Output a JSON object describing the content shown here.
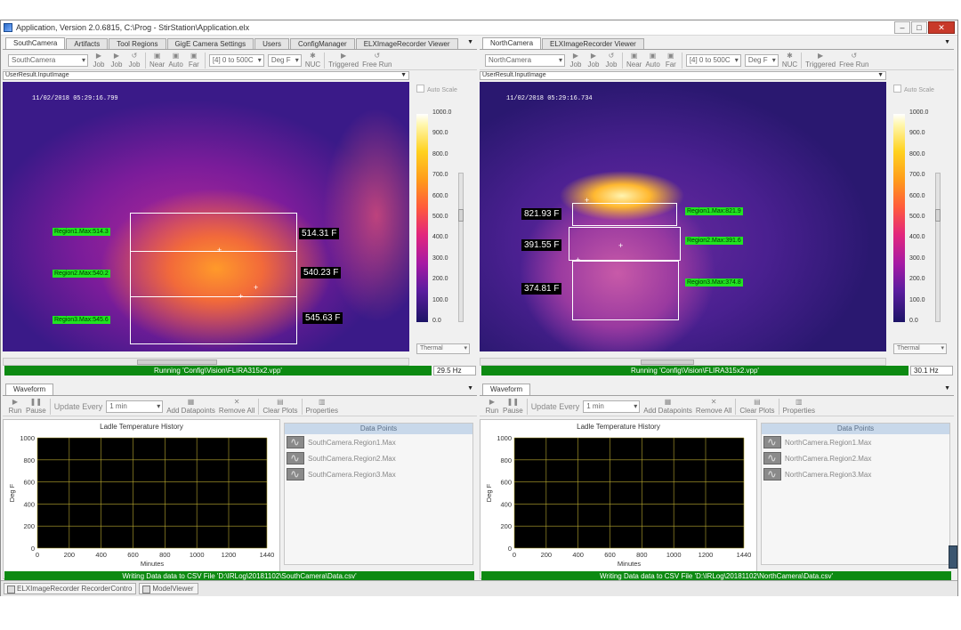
{
  "window": {
    "title": "Application, Version 2.0.6815, C:\\Prog - StirStation\\Application.elx",
    "controls": {
      "minimize": "–",
      "maximize": "□",
      "close": "✕"
    }
  },
  "left": {
    "tabs": [
      "SouthCamera",
      "Artifacts",
      "Tool Regions",
      "GigE Camera Settings",
      "Users",
      "ConfigManager",
      "ELXImageRecorder Viewer"
    ],
    "toolbar": {
      "camera": "SouthCamera",
      "buttons": [
        "Job",
        "Job",
        "Job",
        "Near",
        "Auto",
        "Far"
      ],
      "range": "[4] 0 to 500C",
      "units": "Deg F",
      "nuc": "NUC",
      "triggered": "Triggered",
      "free_run": "Free Run"
    },
    "image_source": "UserResult.InputImage",
    "timestamp": "11/02/2018 05:29:16.799",
    "regions": [
      {
        "label": "Region1.Max:514.3",
        "temp": "514.31 F"
      },
      {
        "label": "Region2.Max:540.2",
        "temp": "540.23 F"
      },
      {
        "label": "Region3.Max:545.6",
        "temp": "545.63 F"
      }
    ],
    "scale": {
      "auto_scale": "Auto Scale",
      "ticks": [
        "1000.0",
        "900.0",
        "800.0",
        "700.0",
        "600.0",
        "500.0",
        "400.0",
        "300.0",
        "200.0",
        "100.0",
        "0.0"
      ],
      "palette": "Thermal"
    },
    "status": "Running 'Config\\Vision\\FLIRA315x2.vpp'",
    "hz": "29.5 Hz",
    "waveform": {
      "tab": "Waveform",
      "toolbar": {
        "run": "Run",
        "pause": "Pause",
        "update_every": "Update Every",
        "interval": "1 min",
        "add": "Add Datapoints",
        "remove": "Remove All",
        "clear": "Clear Plots",
        "properties": "Properties"
      },
      "chart_title": "Ladle Temperature History",
      "data_points_header": "Data Points",
      "series": [
        "SouthCamera.Region1.Max",
        "SouthCamera.Region2.Max",
        "SouthCamera.Region3.Max"
      ]
    },
    "csv_status": "Writing Data data to CSV File 'D:\\IRLog\\20181102\\SouthCamera\\Data.csv'"
  },
  "right": {
    "tabs": [
      "NorthCamera",
      "ELXImageRecorder Viewer"
    ],
    "toolbar": {
      "camera": "NorthCamera",
      "buttons": [
        "Job",
        "Job",
        "Job",
        "Near",
        "Auto",
        "Far"
      ],
      "range": "[4] 0 to 500C",
      "units": "Deg F",
      "nuc": "NUC",
      "triggered": "Triggered",
      "free_run": "Free Run"
    },
    "image_source": "UserResult.InputImage",
    "timestamp": "11/02/2018 05:29:16.734",
    "regions": [
      {
        "label": "Region1.Max:821.9",
        "temp": "821.93 F"
      },
      {
        "label": "Region2.Max:391.6",
        "temp": "391.55 F"
      },
      {
        "label": "Region3.Max:374.8",
        "temp": "374.81 F"
      }
    ],
    "scale": {
      "auto_scale": "Auto Scale",
      "ticks": [
        "1000.0",
        "900.0",
        "800.0",
        "700.0",
        "600.0",
        "500.0",
        "400.0",
        "300.0",
        "200.0",
        "100.0",
        "0.0"
      ],
      "palette": "Thermal"
    },
    "status": "Running 'Config\\Vision\\FLIRA315x2.vpp'",
    "hz": "30.1 Hz",
    "waveform": {
      "tab": "Waveform",
      "toolbar": {
        "run": "Run",
        "pause": "Pause",
        "update_every": "Update Every",
        "interval": "1 min",
        "add": "Add Datapoints",
        "remove": "Remove All",
        "clear": "Clear Plots",
        "properties": "Properties"
      },
      "chart_title": "Ladle Temperature History",
      "data_points_header": "Data Points",
      "series": [
        "NorthCamera.Region1.Max",
        "NorthCamera.Region2.Max",
        "NorthCamera.Region3.Max"
      ]
    },
    "csv_status": "Writing Data data to CSV File 'D:\\IRLog\\20181102\\NorthCamera\\Data.csv'"
  },
  "chart_data": [
    {
      "type": "line",
      "title": "Ladle Temperature History",
      "xlabel": "Minutes",
      "ylabel": "Deg F",
      "xlim": [
        0,
        1440
      ],
      "ylim": [
        0,
        1000
      ],
      "xticks": [
        0,
        200,
        400,
        600,
        800,
        1000,
        1200,
        1440
      ],
      "yticks": [
        0,
        200,
        400,
        600,
        800,
        1000
      ],
      "grid": true,
      "series": [
        {
          "name": "SouthCamera.Region1.Max",
          "values": []
        },
        {
          "name": "SouthCamera.Region2.Max",
          "values": []
        },
        {
          "name": "SouthCamera.Region3.Max",
          "values": []
        }
      ]
    },
    {
      "type": "line",
      "title": "Ladle Temperature History",
      "xlabel": "Minutes",
      "ylabel": "Deg F",
      "xlim": [
        0,
        1440
      ],
      "ylim": [
        0,
        1000
      ],
      "xticks": [
        0,
        200,
        400,
        600,
        800,
        1000,
        1200,
        1440
      ],
      "yticks": [
        0,
        200,
        400,
        600,
        800,
        1000
      ],
      "grid": true,
      "series": [
        {
          "name": "NorthCamera.Region1.Max",
          "values": []
        },
        {
          "name": "NorthCamera.Region2.Max",
          "values": []
        },
        {
          "name": "NorthCamera.Region3.Max",
          "values": []
        }
      ]
    }
  ],
  "bottom_tabs": [
    "ELXImageRecorder RecorderContro",
    "ModelViewer"
  ]
}
